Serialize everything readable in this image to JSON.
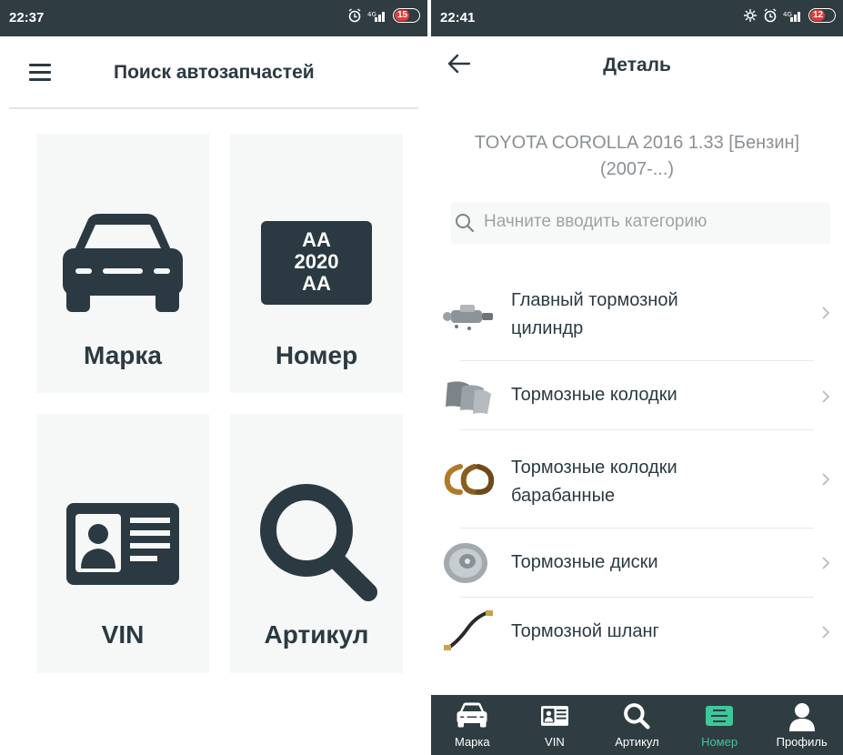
{
  "left": {
    "status": {
      "time": "22:37",
      "battery": "15"
    },
    "header": {
      "title": "Поиск автозапчастей"
    },
    "tiles": [
      {
        "label": "Марка",
        "icon": "car-icon"
      },
      {
        "label": "Номер",
        "icon": "license-plate-icon",
        "plate_lines": [
          "AA",
          "2020",
          "AA"
        ]
      },
      {
        "label": "VIN",
        "icon": "id-card-icon"
      },
      {
        "label": "Артикул",
        "icon": "search-icon"
      }
    ]
  },
  "right": {
    "status": {
      "time": "22:41",
      "battery": "12"
    },
    "header": {
      "title": "Деталь"
    },
    "vehicle": {
      "line1": "TOYOTA COROLLA 2016 1.33 [Бензин]",
      "line2": "(2007-...)"
    },
    "search": {
      "placeholder": "Начните вводить категорию"
    },
    "categories": [
      {
        "line1": "Главный тормозной",
        "line2": "цилиндр",
        "icon": "master-cylinder-icon"
      },
      {
        "line1": "Тормозные колодки",
        "line2": "",
        "icon": "brake-pads-icon"
      },
      {
        "line1": "Тормозные колодки",
        "line2": "барабанные",
        "icon": "drum-brake-shoes-icon"
      },
      {
        "line1": "Тормозные диски",
        "line2": "",
        "icon": "brake-disc-icon"
      },
      {
        "line1": "Тормозной шланг",
        "line2": "",
        "icon": "brake-hose-icon"
      }
    ],
    "bottom_nav": [
      {
        "label": "Марка",
        "icon": "car-icon",
        "active": false
      },
      {
        "label": "VIN",
        "icon": "id-card-icon",
        "active": false
      },
      {
        "label": "Артикул",
        "icon": "search-icon",
        "active": false
      },
      {
        "label": "Номер",
        "icon": "license-plate-icon",
        "active": true
      },
      {
        "label": "Профиль",
        "icon": "profile-icon",
        "active": false
      }
    ]
  },
  "colors": {
    "dark": "#2f3d42",
    "text": "#2b3a42",
    "accent": "#3fc79a",
    "muted": "#8a9094"
  }
}
